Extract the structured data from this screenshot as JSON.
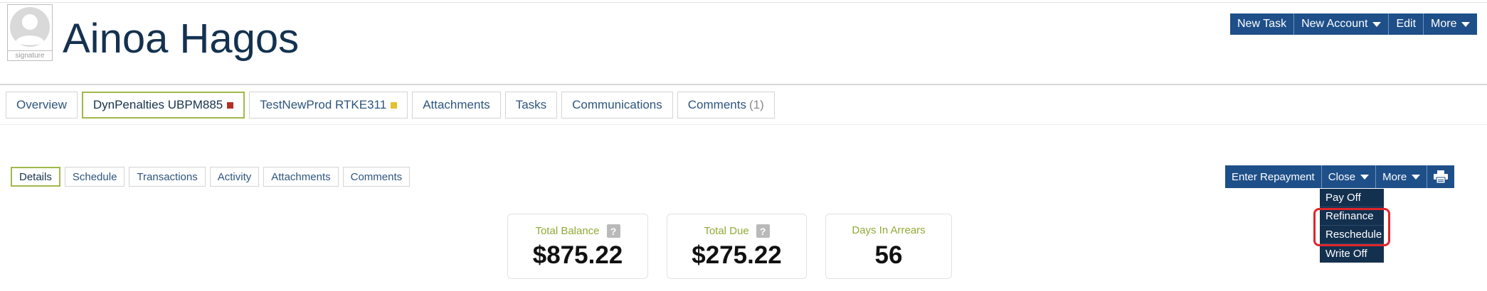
{
  "avatar": {
    "caption": "signature"
  },
  "header": {
    "title": "Ainoa Hagos",
    "actions": [
      {
        "label": "New Task",
        "dropdown": false
      },
      {
        "label": "New Account",
        "dropdown": true
      },
      {
        "label": "Edit",
        "dropdown": false
      },
      {
        "label": "More",
        "dropdown": true
      }
    ]
  },
  "main_tabs": [
    {
      "label": "Overview"
    },
    {
      "label": "DynPenalties UBPM885",
      "active": true,
      "marker_color": "#b03028"
    },
    {
      "label": "TestNewProd RTKE311",
      "marker_color": "#e3c02c"
    },
    {
      "label": "Attachments"
    },
    {
      "label": "Tasks"
    },
    {
      "label": "Communications"
    },
    {
      "label": "Comments",
      "count": "(1)"
    }
  ],
  "sub_tabs": [
    {
      "label": "Details",
      "active": true
    },
    {
      "label": "Schedule"
    },
    {
      "label": "Transactions"
    },
    {
      "label": "Activity"
    },
    {
      "label": "Attachments"
    },
    {
      "label": "Comments"
    }
  ],
  "loan_actions": {
    "enter_repayment": "Enter Repayment",
    "close": "Close",
    "more": "More",
    "print_icon": "printer-icon"
  },
  "close_menu": {
    "items": [
      "Pay Off",
      "Refinance",
      "Reschedule",
      "Write Off"
    ],
    "highlighted": [
      "Refinance",
      "Reschedule"
    ],
    "highlight_color": "#e0262a"
  },
  "stats": [
    {
      "label": "Total Balance",
      "value": "$875.22",
      "help": "?"
    },
    {
      "label": "Total Due",
      "value": "$275.22",
      "help": "?"
    },
    {
      "label": "Days In Arrears",
      "value": "56"
    }
  ],
  "colors": {
    "primary_button": "#1e4f88",
    "active_tab_border": "#9fb949",
    "stat_label": "#8faa36",
    "dropdown_bg": "#14304f"
  }
}
